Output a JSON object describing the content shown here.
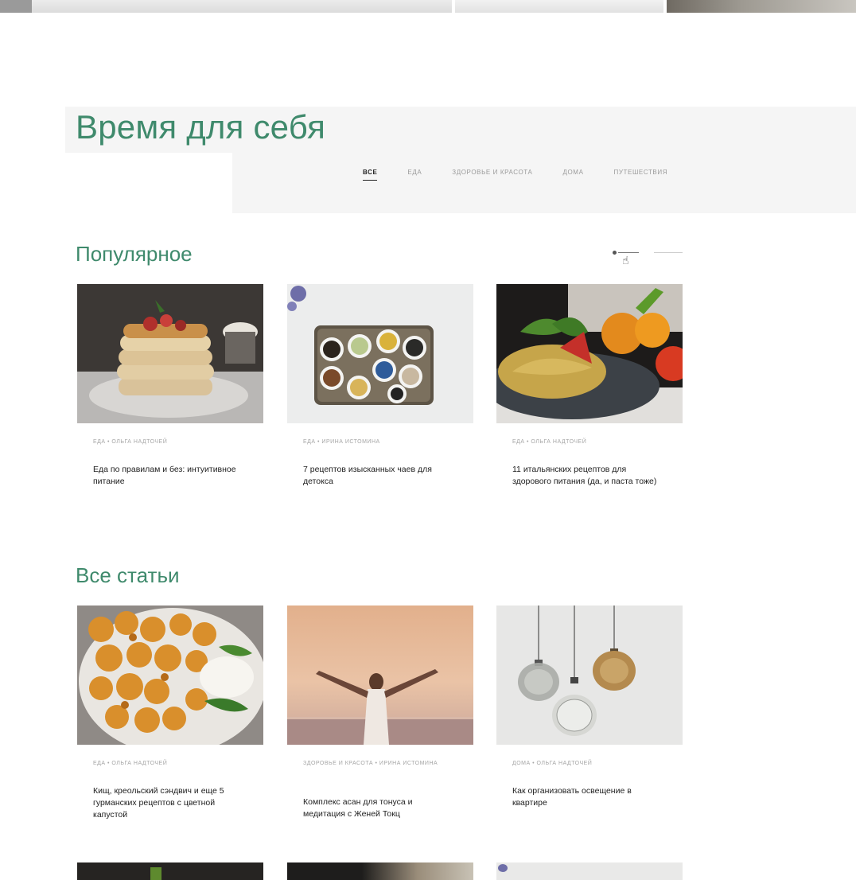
{
  "title": "Время для себя",
  "tabs": [
    {
      "label": "все",
      "active": true
    },
    {
      "label": "еда",
      "active": false
    },
    {
      "label": "здоровье и красота",
      "active": false
    },
    {
      "label": "дома",
      "active": false
    },
    {
      "label": "путешествия",
      "active": false
    }
  ],
  "popular": {
    "heading": "Популярное",
    "cards": [
      {
        "meta": "еда • ольга надточей",
        "headline": "Еда по правилам и без: интуитивное питание",
        "image": "pancakes-photo"
      },
      {
        "meta": "еда • ирина истомина",
        "headline": "7 рецептов изысканных чаев для детокса",
        "image": "tea-cups-photo"
      },
      {
        "meta": "еда • ольга надточей",
        "headline": "11 итальянских рецептов для здорового питания (да, и паста тоже)",
        "image": "pasta-photo"
      }
    ]
  },
  "all_articles": {
    "heading": "Все статьи",
    "cards": [
      {
        "meta": "еда • ольга надточей",
        "headline": "Кищ, креольский сэндвич и еще 5 гурманских рецептов с цветной капустой",
        "image": "cauliflower-photo"
      },
      {
        "meta": "здоровье и красота • ирина истомина",
        "headline": "Комплекс асан для тонуса и медитация с Женей Токц",
        "image": "sunset-woman-photo"
      },
      {
        "meta": "дома • ольга надточей",
        "headline": "Как организовать освещение в квартире",
        "image": "pendant-lamps-photo"
      }
    ]
  },
  "colors": {
    "accent": "#3f8a6c",
    "panel": "#f5f5f5",
    "meta": "#a6a6a6"
  }
}
